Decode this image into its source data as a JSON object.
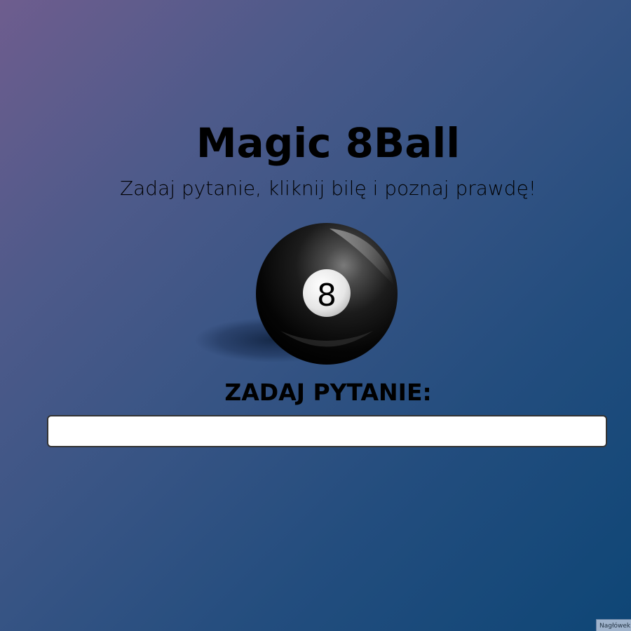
{
  "header": {
    "title": "Magic 8Ball",
    "subtitle": "Zadaj pytanie, kliknij bilę i poznaj prawdę!"
  },
  "ball": {
    "number": "8",
    "color": "#000000"
  },
  "question": {
    "label": "ZADAJ PYTANIE:",
    "value": "",
    "placeholder": ""
  },
  "corner_tab": {
    "label": "Nagłówek"
  },
  "colors": {
    "gradient_start": "#6e5d8e",
    "gradient_end": "#0e4676"
  }
}
